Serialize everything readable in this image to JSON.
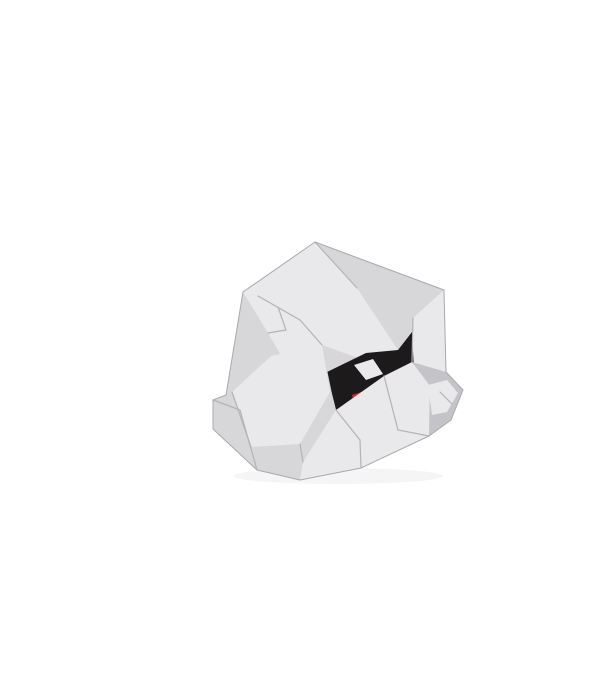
{
  "scene": {
    "subject": "crumpled-paper-ball",
    "background_color": "#ffffff",
    "colors": {
      "paper_light": "#e9e9eb",
      "paper_mid": "#d7d7da",
      "paper_shadow": "#c4c4c8",
      "paper_deep_shadow": "#b3b3b8",
      "cavity_dark": "#1c1a1b",
      "red_patch": "#d8262c",
      "outline": "#a9a9ae"
    }
  }
}
